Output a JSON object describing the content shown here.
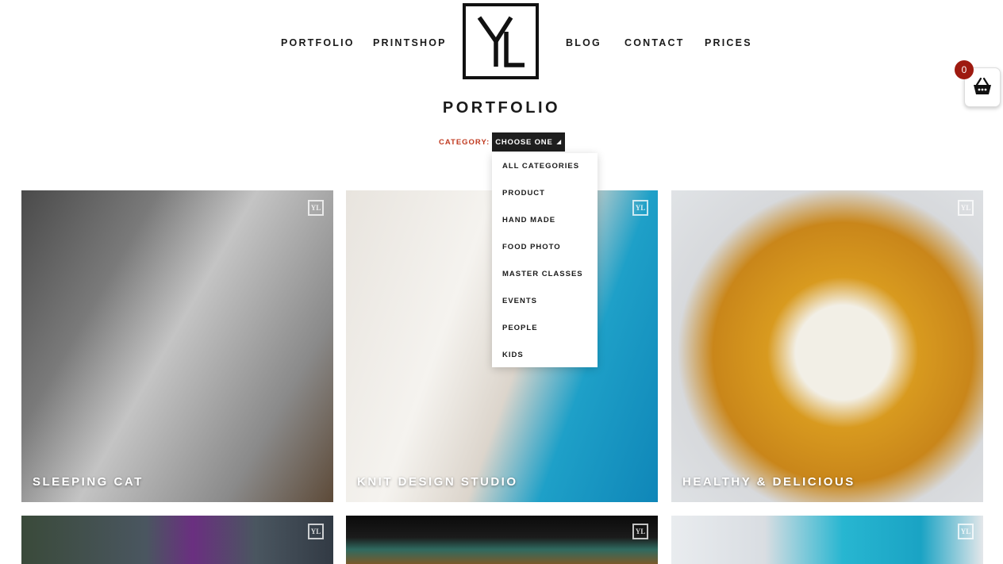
{
  "nav": {
    "left": [
      "PORTFOLIO",
      "PRINTSHOP"
    ],
    "right": [
      "BLOG",
      "CONTACT",
      "PRICES"
    ]
  },
  "page_title": "PORTFOLIO",
  "filter": {
    "label": "CATEGORY:",
    "selected": "CHOOSE ONE",
    "options": [
      "ALL CATEGORIES",
      "PRODUCT",
      "HAND MADE",
      "FOOD PHOTO",
      "MASTER CLASSES",
      "EVENTS",
      "PEOPLE",
      "KIDS"
    ]
  },
  "cart": {
    "count": "0",
    "icon": "basket-icon"
  },
  "tiles": [
    {
      "title": "SLEEPING CAT"
    },
    {
      "title": "KNIT DESIGN STUDIO"
    },
    {
      "title": "HEALTHY & DELICIOUS"
    },
    {
      "title": ""
    },
    {
      "title": ""
    },
    {
      "title": ""
    }
  ],
  "colors": {
    "accent": "#c0391f",
    "badge": "#9e1a10",
    "dark_button": "#1e1e1e"
  }
}
